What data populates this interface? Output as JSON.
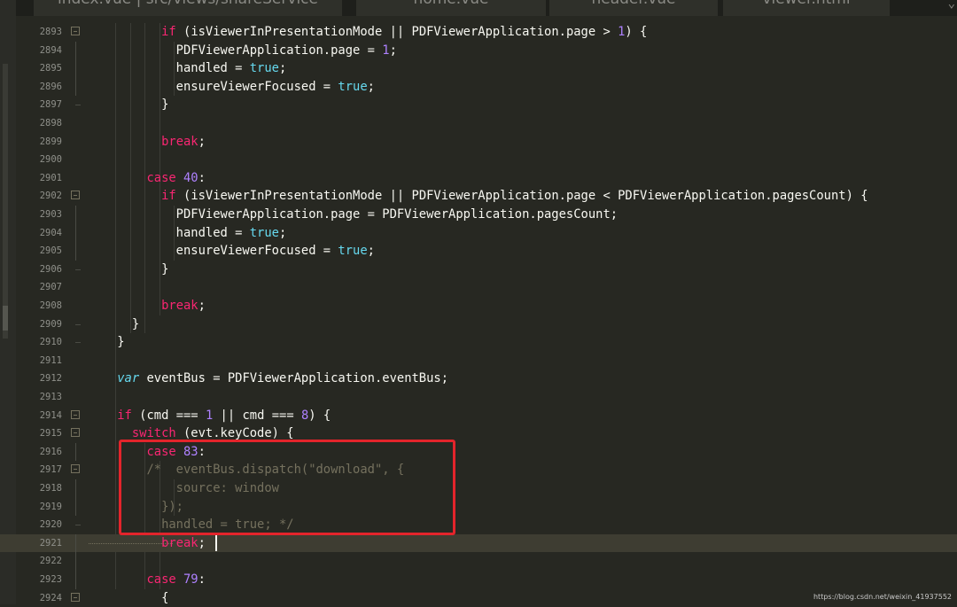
{
  "tabs": [
    {
      "label": "index.vue | src/views/shareService"
    },
    {
      "label": "home.vue"
    },
    {
      "label": "header.vue"
    },
    {
      "label": "viewer.html"
    }
  ],
  "lines": [
    {
      "num": "2893",
      "fold": "start",
      "tokens": [
        {
          "t": "          "
        },
        {
          "t": "if",
          "c": "kw"
        },
        {
          "t": " (isViewerInPresentationMode || PDFViewerApplication.page > "
        },
        {
          "t": "1",
          "c": "num"
        },
        {
          "t": ") {"
        }
      ]
    },
    {
      "num": "2894",
      "fold": "line",
      "tokens": [
        {
          "t": "            PDFViewerApplication.page = "
        },
        {
          "t": "1",
          "c": "num"
        },
        {
          "t": ";"
        }
      ]
    },
    {
      "num": "2895",
      "fold": "line",
      "tokens": [
        {
          "t": "            handled = "
        },
        {
          "t": "true",
          "c": "cst"
        },
        {
          "t": ";"
        }
      ]
    },
    {
      "num": "2896",
      "fold": "line",
      "tokens": [
        {
          "t": "            ensureViewerFocused = "
        },
        {
          "t": "true",
          "c": "cst"
        },
        {
          "t": ";"
        }
      ]
    },
    {
      "num": "2897",
      "fold": "end",
      "tokens": [
        {
          "t": "          }"
        }
      ]
    },
    {
      "num": "2898",
      "fold": "",
      "tokens": []
    },
    {
      "num": "2899",
      "fold": "",
      "tokens": [
        {
          "t": "          "
        },
        {
          "t": "break",
          "c": "kw"
        },
        {
          "t": ";"
        }
      ]
    },
    {
      "num": "2900",
      "fold": "",
      "tokens": []
    },
    {
      "num": "2901",
      "fold": "",
      "tokens": [
        {
          "t": "        "
        },
        {
          "t": "case",
          "c": "kw"
        },
        {
          "t": " "
        },
        {
          "t": "40",
          "c": "num"
        },
        {
          "t": ":"
        }
      ]
    },
    {
      "num": "2902",
      "fold": "start",
      "tokens": [
        {
          "t": "          "
        },
        {
          "t": "if",
          "c": "kw"
        },
        {
          "t": " (isViewerInPresentationMode || PDFViewerApplication.page < PDFViewerApplication.pagesCount) {"
        }
      ]
    },
    {
      "num": "2903",
      "fold": "line",
      "tokens": [
        {
          "t": "            PDFViewerApplication.page = PDFViewerApplication.pagesCount;"
        }
      ]
    },
    {
      "num": "2904",
      "fold": "line",
      "tokens": [
        {
          "t": "            handled = "
        },
        {
          "t": "true",
          "c": "cst"
        },
        {
          "t": ";"
        }
      ]
    },
    {
      "num": "2905",
      "fold": "line",
      "tokens": [
        {
          "t": "            ensureViewerFocused = "
        },
        {
          "t": "true",
          "c": "cst"
        },
        {
          "t": ";"
        }
      ]
    },
    {
      "num": "2906",
      "fold": "end",
      "tokens": [
        {
          "t": "          }"
        }
      ]
    },
    {
      "num": "2907",
      "fold": "",
      "tokens": []
    },
    {
      "num": "2908",
      "fold": "",
      "tokens": [
        {
          "t": "          "
        },
        {
          "t": "break",
          "c": "kw"
        },
        {
          "t": ";"
        }
      ]
    },
    {
      "num": "2909",
      "fold": "end",
      "tokens": [
        {
          "t": "      }"
        }
      ]
    },
    {
      "num": "2910",
      "fold": "end",
      "tokens": [
        {
          "t": "    }"
        }
      ]
    },
    {
      "num": "2911",
      "fold": "",
      "tokens": []
    },
    {
      "num": "2912",
      "fold": "",
      "tokens": [
        {
          "t": "    "
        },
        {
          "t": "var",
          "c": "var"
        },
        {
          "t": " eventBus = PDFViewerApplication.eventBus;"
        }
      ]
    },
    {
      "num": "2913",
      "fold": "",
      "tokens": []
    },
    {
      "num": "2914",
      "fold": "start",
      "tokens": [
        {
          "t": "    "
        },
        {
          "t": "if",
          "c": "kw"
        },
        {
          "t": " (cmd === "
        },
        {
          "t": "1",
          "c": "num"
        },
        {
          "t": " || cmd === "
        },
        {
          "t": "8",
          "c": "num"
        },
        {
          "t": ") {"
        }
      ]
    },
    {
      "num": "2915",
      "fold": "start",
      "tokens": [
        {
          "t": "      "
        },
        {
          "t": "switch",
          "c": "kw"
        },
        {
          "t": " (evt.keyCode) {"
        }
      ]
    },
    {
      "num": "2916",
      "fold": "line",
      "tokens": [
        {
          "t": "        "
        },
        {
          "t": "case",
          "c": "kw"
        },
        {
          "t": " "
        },
        {
          "t": "83",
          "c": "num"
        },
        {
          "t": ":"
        }
      ]
    },
    {
      "num": "2917",
      "fold": "start",
      "tokens": [
        {
          "t": "        "
        },
        {
          "t": "/*  eventBus.dispatch(\"download\", {",
          "c": "cmt"
        }
      ]
    },
    {
      "num": "2918",
      "fold": "line",
      "tokens": [
        {
          "t": "            source: window",
          "c": "cmt"
        }
      ]
    },
    {
      "num": "2919",
      "fold": "line",
      "tokens": [
        {
          "t": "          });",
          "c": "cmt"
        }
      ]
    },
    {
      "num": "2920",
      "fold": "end",
      "tokens": [
        {
          "t": "          handled = true; */",
          "c": "cmt"
        }
      ]
    },
    {
      "num": "2921",
      "fold": "line",
      "current": true,
      "tokens": [
        {
          "t": "          "
        },
        {
          "t": "break",
          "c": "kw"
        },
        {
          "t": ";"
        }
      ]
    },
    {
      "num": "2922",
      "fold": "line",
      "tokens": []
    },
    {
      "num": "2923",
      "fold": "line",
      "tokens": [
        {
          "t": "        "
        },
        {
          "t": "case",
          "c": "kw"
        },
        {
          "t": " "
        },
        {
          "t": "79",
          "c": "num"
        },
        {
          "t": ":"
        }
      ]
    },
    {
      "num": "2924",
      "fold": "start",
      "tokens": [
        {
          "t": "          {"
        }
      ]
    }
  ],
  "watermark": "https://blog.csdn.net/weixin_41937552",
  "colors": {
    "background": "#272822",
    "keyword": "#f92672",
    "number": "#ae81ff",
    "constant": "#66d9ef",
    "comment": "#75715e",
    "highlight_box": "#e3242b"
  }
}
